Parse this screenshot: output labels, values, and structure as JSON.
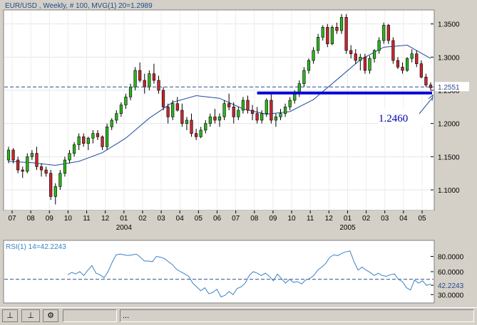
{
  "colors": {
    "up_candle": "#2db51c",
    "down_candle": "#c8262e",
    "ma_line": "#1d4d9a",
    "support_line": "#0000d8",
    "rsi_line": "#3b82c4",
    "dashed_level": "#2a4a8a",
    "panel_bg": "#ffffff"
  },
  "chart_data": [
    {
      "type": "candlestick",
      "title": "EUR/USD , Weekly, # 100, MVG(1) 20=1.2989",
      "xlabel": "",
      "ylabel": "",
      "ylim": [
        1.07,
        1.37
      ],
      "grid": true,
      "x_ticks": [
        "07",
        "08",
        "09",
        "10",
        "11",
        "12",
        "01",
        "02",
        "03",
        "04",
        "05",
        "06",
        "07",
        "08",
        "09",
        "10",
        "11",
        "12",
        "01",
        "02",
        "03",
        "04",
        "05"
      ],
      "year_labels": [
        {
          "label": "2004",
          "at_month_index": 6
        },
        {
          "label": "2005",
          "at_month_index": 18
        }
      ],
      "y_ticks": [
        "1.3500",
        "1.3000",
        "1.2500",
        "1.2000",
        "1.1500",
        "1.1000"
      ],
      "last_price_label": "1.2551",
      "last_price": 1.2551,
      "annotation": {
        "text": "1.2460",
        "level": 1.246
      },
      "ohlc": [
        [
          1.145,
          1.165,
          1.14,
          1.16
        ],
        [
          1.16,
          1.163,
          1.14,
          1.145
        ],
        [
          1.145,
          1.15,
          1.125,
          1.13
        ],
        [
          1.13,
          1.135,
          1.118,
          1.128
        ],
        [
          1.128,
          1.155,
          1.125,
          1.15
        ],
        [
          1.15,
          1.16,
          1.145,
          1.155
        ],
        [
          1.155,
          1.165,
          1.13,
          1.135
        ],
        [
          1.135,
          1.14,
          1.12,
          1.13
        ],
        [
          1.13,
          1.135,
          1.12,
          1.125
        ],
        [
          1.125,
          1.13,
          1.085,
          1.09
        ],
        [
          1.09,
          1.11,
          1.078,
          1.105
        ],
        [
          1.105,
          1.13,
          1.1,
          1.125
        ],
        [
          1.125,
          1.15,
          1.12,
          1.145
        ],
        [
          1.145,
          1.16,
          1.14,
          1.155
        ],
        [
          1.155,
          1.172,
          1.15,
          1.168
        ],
        [
          1.168,
          1.185,
          1.16,
          1.18
        ],
        [
          1.18,
          1.185,
          1.165,
          1.17
        ],
        [
          1.17,
          1.18,
          1.16,
          1.178
        ],
        [
          1.178,
          1.19,
          1.17,
          1.185
        ],
        [
          1.185,
          1.19,
          1.175,
          1.18
        ],
        [
          1.18,
          1.182,
          1.16,
          1.165
        ],
        [
          1.165,
          1.2,
          1.16,
          1.195
        ],
        [
          1.195,
          1.208,
          1.19,
          1.205
        ],
        [
          1.205,
          1.22,
          1.2,
          1.215
        ],
        [
          1.215,
          1.232,
          1.21,
          1.228
        ],
        [
          1.228,
          1.245,
          1.222,
          1.24
        ],
        [
          1.24,
          1.26,
          1.235,
          1.255
        ],
        [
          1.255,
          1.285,
          1.25,
          1.28
        ],
        [
          1.28,
          1.292,
          1.262,
          1.265
        ],
        [
          1.265,
          1.275,
          1.245,
          1.255
        ],
        [
          1.255,
          1.28,
          1.25,
          1.275
        ],
        [
          1.275,
          1.29,
          1.26,
          1.265
        ],
        [
          1.265,
          1.272,
          1.245,
          1.25
        ],
        [
          1.25,
          1.255,
          1.22,
          1.225
        ],
        [
          1.225,
          1.23,
          1.2,
          1.21
        ],
        [
          1.21,
          1.235,
          1.205,
          1.23
        ],
        [
          1.23,
          1.24,
          1.218,
          1.22
        ],
        [
          1.22,
          1.23,
          1.195,
          1.2
        ],
        [
          1.2,
          1.21,
          1.19,
          1.205
        ],
        [
          1.205,
          1.215,
          1.18,
          1.185
        ],
        [
          1.185,
          1.192,
          1.175,
          1.18
        ],
        [
          1.18,
          1.195,
          1.178,
          1.19
        ],
        [
          1.19,
          1.205,
          1.185,
          1.2
        ],
        [
          1.2,
          1.215,
          1.195,
          1.21
        ],
        [
          1.21,
          1.222,
          1.2,
          1.205
        ],
        [
          1.205,
          1.215,
          1.195,
          1.21
        ],
        [
          1.21,
          1.235,
          1.205,
          1.23
        ],
        [
          1.23,
          1.245,
          1.22,
          1.225
        ],
        [
          1.225,
          1.232,
          1.2,
          1.21
        ],
        [
          1.21,
          1.225,
          1.205,
          1.22
        ],
        [
          1.22,
          1.24,
          1.215,
          1.235
        ],
        [
          1.235,
          1.242,
          1.215,
          1.22
        ],
        [
          1.22,
          1.228,
          1.205,
          1.215
        ],
        [
          1.215,
          1.225,
          1.2,
          1.205
        ],
        [
          1.205,
          1.22,
          1.2,
          1.215
        ],
        [
          1.215,
          1.238,
          1.21,
          1.235
        ],
        [
          1.235,
          1.245,
          1.2,
          1.205
        ],
        [
          1.205,
          1.215,
          1.195,
          1.21
        ],
        [
          1.21,
          1.222,
          1.205,
          1.215
        ],
        [
          1.215,
          1.23,
          1.21,
          1.225
        ],
        [
          1.225,
          1.24,
          1.22,
          1.235
        ],
        [
          1.235,
          1.25,
          1.23,
          1.245
        ],
        [
          1.245,
          1.265,
          1.24,
          1.26
        ],
        [
          1.26,
          1.285,
          1.255,
          1.28
        ],
        [
          1.28,
          1.298,
          1.275,
          1.295
        ],
        [
          1.295,
          1.315,
          1.29,
          1.31
        ],
        [
          1.31,
          1.335,
          1.305,
          1.33
        ],
        [
          1.33,
          1.348,
          1.325,
          1.345
        ],
        [
          1.345,
          1.35,
          1.315,
          1.32
        ],
        [
          1.32,
          1.348,
          1.318,
          1.345
        ],
        [
          1.345,
          1.352,
          1.335,
          1.34
        ],
        [
          1.34,
          1.365,
          1.335,
          1.36
        ],
        [
          1.36,
          1.365,
          1.305,
          1.31
        ],
        [
          1.31,
          1.318,
          1.298,
          1.305
        ],
        [
          1.305,
          1.312,
          1.29,
          1.295
        ],
        [
          1.295,
          1.305,
          1.28,
          1.3
        ],
        [
          1.3,
          1.305,
          1.275,
          1.28
        ],
        [
          1.28,
          1.302,
          1.275,
          1.298
        ],
        [
          1.298,
          1.312,
          1.292,
          1.31
        ],
        [
          1.31,
          1.33,
          1.305,
          1.325
        ],
        [
          1.325,
          1.352,
          1.32,
          1.348
        ],
        [
          1.348,
          1.35,
          1.32,
          1.325
        ],
        [
          1.325,
          1.33,
          1.29,
          1.295
        ],
        [
          1.295,
          1.3,
          1.282,
          1.285
        ],
        [
          1.285,
          1.292,
          1.275,
          1.28
        ],
        [
          1.28,
          1.3,
          1.278,
          1.298
        ],
        [
          1.298,
          1.312,
          1.292,
          1.305
        ],
        [
          1.305,
          1.31,
          1.285,
          1.29
        ],
        [
          1.29,
          1.295,
          1.268,
          1.27
        ],
        [
          1.27,
          1.275,
          1.255,
          1.258
        ],
        [
          1.258,
          1.262,
          1.25,
          1.254
        ]
      ],
      "ma_name": "MVG(1) 20",
      "ma": [
        [
          0,
          1.143
        ],
        [
          5,
          1.141
        ],
        [
          10,
          1.137
        ],
        [
          15,
          1.143
        ],
        [
          20,
          1.156
        ],
        [
          25,
          1.178
        ],
        [
          30,
          1.208
        ],
        [
          35,
          1.232
        ],
        [
          40,
          1.242
        ],
        [
          45,
          1.238
        ],
        [
          50,
          1.222
        ],
        [
          55,
          1.214
        ],
        [
          60,
          1.218
        ],
        [
          65,
          1.236
        ],
        [
          70,
          1.266
        ],
        [
          75,
          1.296
        ],
        [
          80,
          1.315
        ],
        [
          85,
          1.318
        ],
        [
          90,
          1.298
        ]
      ]
    },
    {
      "type": "line",
      "title": "RSI(1) 14=42.2243",
      "ylim": [
        20,
        100
      ],
      "y_ticks": [
        "80.0000",
        "60.0000",
        "42.2243",
        "30.0000"
      ],
      "dashed_level": 50,
      "series": [
        {
          "values": [
            56,
            59,
            57,
            60,
            55,
            62,
            68,
            58,
            56,
            52,
            60,
            72,
            82,
            83,
            82,
            81,
            82,
            83,
            79,
            74,
            74,
            73,
            80,
            79,
            77,
            73,
            69,
            63,
            60,
            57,
            54,
            45,
            40,
            35,
            39,
            31,
            33,
            37,
            27,
            29,
            34,
            30,
            38,
            40,
            45,
            55,
            60,
            58,
            55,
            58,
            54,
            48,
            57,
            51,
            45,
            50,
            46,
            47,
            44,
            49,
            51,
            55,
            62,
            66,
            71,
            79,
            82,
            81,
            84,
            86,
            87,
            73,
            62,
            66,
            62,
            59,
            55,
            58,
            55,
            54,
            56,
            57,
            50,
            47,
            39,
            36,
            49,
            45,
            48,
            42,
            44
          ]
        }
      ]
    }
  ],
  "toolbar": {
    "btn1_glyph": "⊥",
    "btn2_glyph": "⊥",
    "btn3_glyph": "⚙",
    "status_text": "...",
    "status_empty": ""
  }
}
